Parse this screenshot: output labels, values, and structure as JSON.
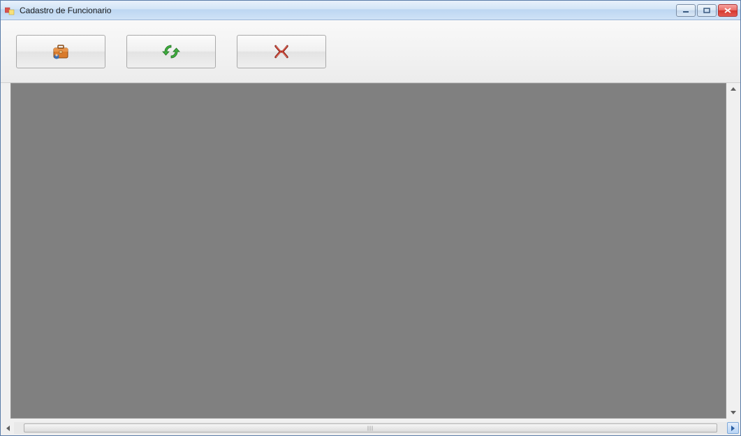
{
  "window": {
    "title": "Cadastro de Funcionario"
  },
  "toolbar": {
    "buttons": [
      {
        "name": "add-employee-button",
        "icon": "briefcase-user-icon"
      },
      {
        "name": "refresh-button",
        "icon": "refresh-icon"
      },
      {
        "name": "delete-button",
        "icon": "delete-x-icon"
      }
    ]
  },
  "grid": {
    "columns": [],
    "rows": []
  }
}
